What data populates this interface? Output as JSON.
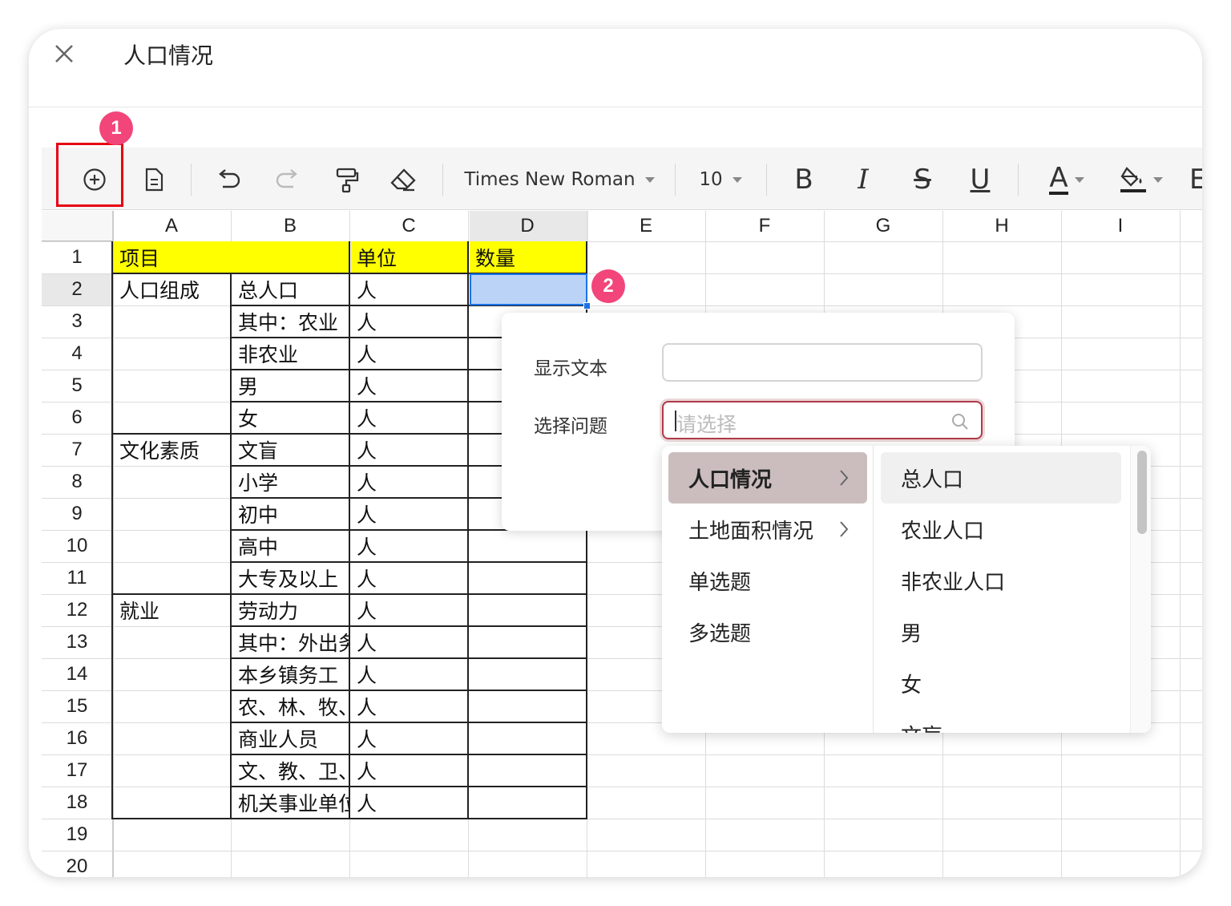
{
  "window": {
    "title": "人口情况"
  },
  "toolbar": {
    "font_name": "Times New Roman",
    "font_size": "10",
    "bold": "B",
    "italic": "I",
    "strike": "S",
    "underline": "U",
    "font_color": "A",
    "more": "E"
  },
  "annotations": {
    "step1": "1",
    "step2": "2"
  },
  "sheet": {
    "columns": [
      "A",
      "B",
      "C",
      "D",
      "E",
      "F",
      "G",
      "H",
      "I"
    ],
    "rows": [
      "1",
      "2",
      "3",
      "4",
      "5",
      "6",
      "7",
      "8",
      "9",
      "10",
      "11",
      "12",
      "13",
      "14",
      "15",
      "16",
      "17",
      "18",
      "19",
      "20"
    ],
    "header": {
      "a": "项目",
      "c": "单位",
      "d": "数量"
    },
    "groups": [
      "人口组成",
      "文化素质",
      "就业"
    ],
    "items": [
      "总人口",
      "其中：农业",
      "非农业",
      "男",
      "女",
      "文盲",
      "小学",
      "初中",
      "高中",
      "大专及以上",
      "劳动力",
      "其中：外出务",
      "本乡镇务工",
      "农、林、牧、",
      "商业人员",
      "文、教、卫、",
      "机关事业单位"
    ],
    "unit": "人"
  },
  "popup": {
    "display_text_label": "显示文本",
    "display_text_value": "",
    "select_question_label": "选择问题",
    "select_placeholder": "请选择"
  },
  "dropdown": {
    "categories": [
      {
        "label": "人口情况",
        "has_children": true,
        "selected": true
      },
      {
        "label": "土地面积情况",
        "has_children": true,
        "selected": false
      },
      {
        "label": "单选题",
        "has_children": false,
        "selected": false
      },
      {
        "label": "多选题",
        "has_children": false,
        "selected": false
      }
    ],
    "options": [
      "总人口",
      "农业人口",
      "非农业人口",
      "男",
      "女",
      "文盲"
    ]
  },
  "colors": {
    "accent_red": "#e60012",
    "badge_pink": "#f2457a",
    "header_yellow": "#ffff00",
    "selection_blue": "#1a73e8",
    "selected_category": "#cbbdbe"
  }
}
